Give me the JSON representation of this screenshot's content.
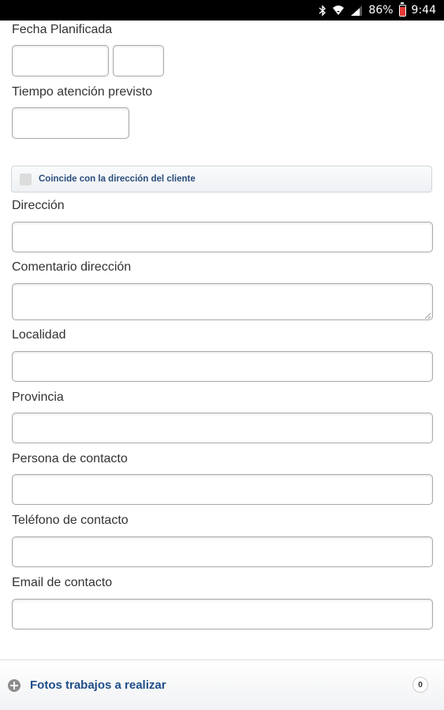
{
  "status_bar": {
    "battery": "86%",
    "time": "9:44",
    "icons": [
      "bluetooth-icon",
      "wifi-icon",
      "signal-icon",
      "battery-icon"
    ]
  },
  "form": {
    "fecha_label": "Fecha Planificada",
    "fecha_value": "",
    "hora_value": "",
    "tiempo_label": "Tiempo atención previsto",
    "tiempo_value": "",
    "coincide_label": "Coincide con la dirección del cliente",
    "coincide_checked": false,
    "direccion_label": "Dirección",
    "direccion_value": "",
    "comentario_label": "Comentario dirección",
    "comentario_value": "",
    "localidad_label": "Localidad",
    "localidad_value": "",
    "provincia_label": "Provincia",
    "provincia_value": "",
    "persona_label": "Persona de contacto",
    "persona_value": "",
    "telefono_label": "Teléfono de contacto",
    "telefono_value": "",
    "email_label": "Email de contacto",
    "email_value": ""
  },
  "fotos": {
    "title": "Fotos trabajos a realizar",
    "count": "0"
  }
}
